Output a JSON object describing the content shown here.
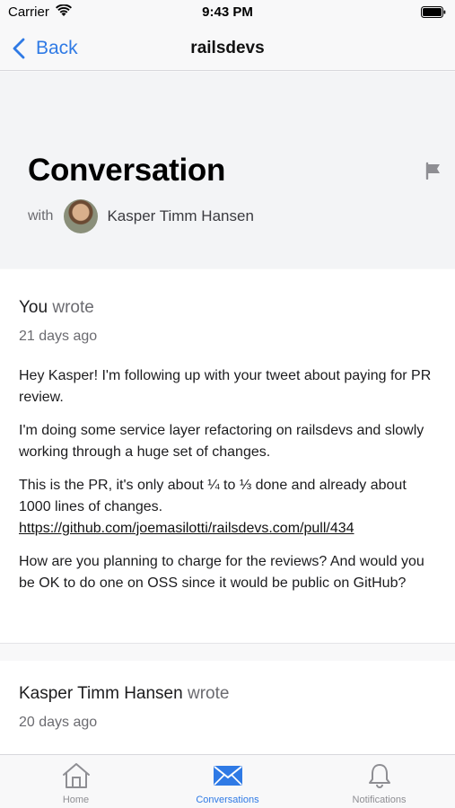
{
  "status_bar": {
    "carrier": "Carrier",
    "time": "9:43 PM"
  },
  "nav": {
    "back_label": "Back",
    "title": "railsdevs"
  },
  "header": {
    "title": "Conversation",
    "with_label": "with",
    "participant_name": "Kasper Timm Hansen"
  },
  "messages": [
    {
      "author": "You",
      "wrote_label": "wrote",
      "timestamp": "21 days ago",
      "paragraphs": [
        "Hey Kasper! I'm following up with your tweet about paying for PR review.",
        "I'm doing some service layer refactoring on railsdevs and slowly working through a huge set of changes.",
        "This is the PR, it's only about ¼ to ⅓ done and already about 1000 lines of changes.",
        "How are you planning to charge for the reviews? And would you be OK to do one on OSS since it would be public on GitHub?"
      ],
      "link": "https://github.com/joemasilotti/railsdevs.com/pull/434"
    },
    {
      "author": "Kasper Timm Hansen",
      "wrote_label": "wrote",
      "timestamp": "20 days ago"
    }
  ],
  "tabs": [
    {
      "label": "Home",
      "icon": "home-icon",
      "active": false
    },
    {
      "label": "Conversations",
      "icon": "envelope-icon",
      "active": true
    },
    {
      "label": "Notifications",
      "icon": "bell-icon",
      "active": false
    }
  ],
  "colors": {
    "accent": "#2f7ae5",
    "inactive": "#8e8e93"
  }
}
